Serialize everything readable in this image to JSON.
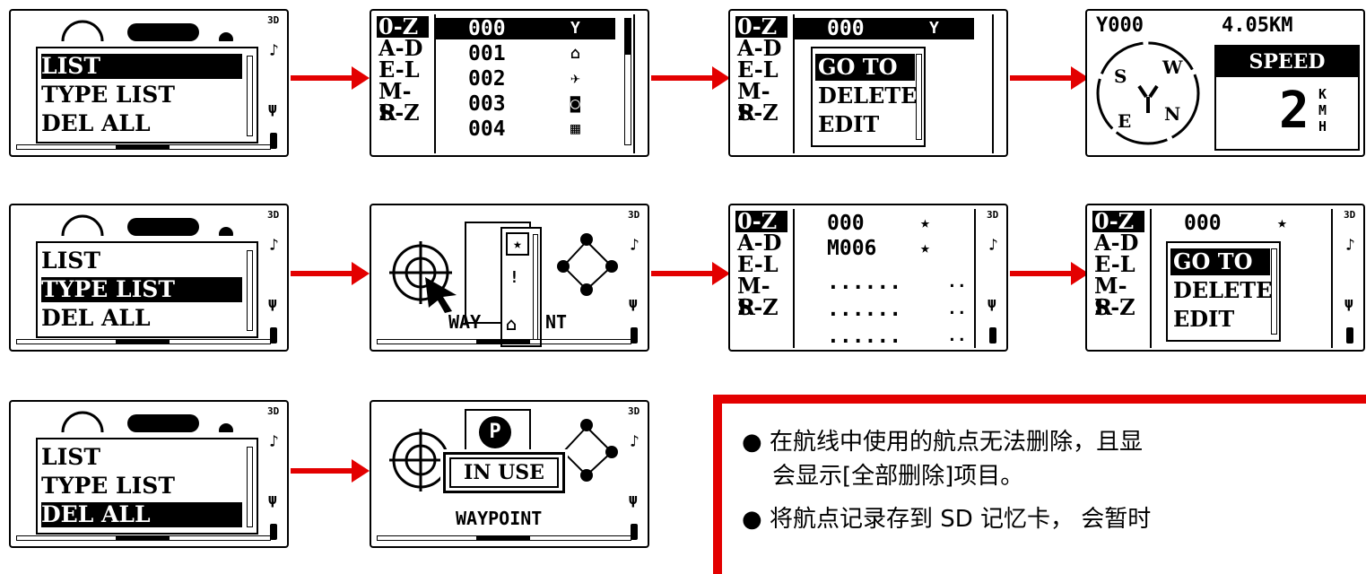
{
  "status": {
    "mode_3d": "3D",
    "note_icon": "music-note",
    "plug_icon": "power-plug",
    "battery_icon": "battery"
  },
  "main_menu": {
    "items": [
      "LIST",
      "TYPE LIST",
      "DEL ALL"
    ]
  },
  "index": [
    "0-Z",
    "A-D",
    "E-L",
    "M-R",
    "S-Z"
  ],
  "waypoint_list": [
    {
      "code": "000",
      "icon": "Y"
    },
    {
      "code": "001",
      "icon": "⌂"
    },
    {
      "code": "002",
      "icon": "✈"
    },
    {
      "code": "003",
      "icon": "◙"
    },
    {
      "code": "004",
      "icon": "▦"
    }
  ],
  "popup": {
    "items": [
      "GO TO",
      "DELETE",
      "EDIT"
    ]
  },
  "nav": {
    "waypoint": "000",
    "distance": "4.05KM",
    "speed_label": "SPEED",
    "speed_value": "2",
    "speed_unit": "KMH",
    "compass": [
      "S",
      "W",
      "E",
      "N"
    ]
  },
  "type_screen": {
    "label": "WAYPOINT",
    "partial_label_left": "WAY",
    "partial_label_right": "NT"
  },
  "type_list": [
    {
      "code": "000",
      "icon": "★"
    },
    {
      "code": "M006",
      "icon": "★"
    },
    {
      "code": "......",
      "icon": ".."
    },
    {
      "code": "......",
      "icon": ".."
    },
    {
      "code": "......",
      "icon": ".."
    }
  ],
  "in_use": {
    "label": "IN USE"
  },
  "notes": {
    "bullet": "●",
    "line1": "在航线中使用的航点无法删除，且显",
    "line2": "会显示[全部删除]项目。",
    "line3": "将航点记录存到 SD 记忆卡， 会暂时"
  },
  "colors": {
    "arrow": "#e30000",
    "box_border": "#e30000"
  }
}
